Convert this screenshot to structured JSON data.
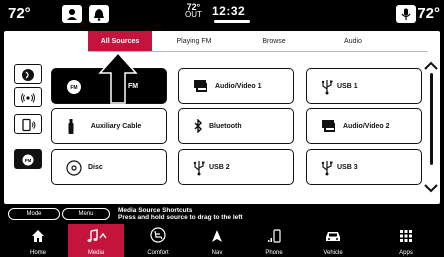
{
  "status": {
    "temp_left": "72°",
    "temp_right": "72°",
    "outside_temp": "72°",
    "outside_label": "OUT",
    "time": "12:32"
  },
  "tabs": [
    {
      "label": "All Sources",
      "active": true
    },
    {
      "label": "Playing FM",
      "active": false
    },
    {
      "label": "Browse",
      "active": false
    },
    {
      "label": "Audio",
      "active": false
    }
  ],
  "sources": [
    {
      "label": "FM",
      "icon": "fm-icon",
      "selected": true
    },
    {
      "label": "Audio/Video 1",
      "icon": "audio-video-icon",
      "selected": false
    },
    {
      "label": "USB 1",
      "icon": "usb-icon",
      "selected": false
    },
    {
      "label": "Auxiliary Cable",
      "icon": "aux-cable-icon",
      "selected": false
    },
    {
      "label": "Bluetooth",
      "icon": "bluetooth-icon",
      "selected": false
    },
    {
      "label": "Audio/Video 2",
      "icon": "audio-video-icon",
      "selected": false
    },
    {
      "label": "Disc",
      "icon": "disc-icon",
      "selected": false
    },
    {
      "label": "USB 2",
      "icon": "usb-icon",
      "selected": false
    },
    {
      "label": "USB 3",
      "icon": "usb-icon",
      "selected": false
    }
  ],
  "shortcuts": {
    "mode_label": "Mode",
    "menu_label": "Menu",
    "title": "Media Source Shortcuts",
    "hint": "Press and hold source to drag to the left"
  },
  "nav": [
    {
      "label": "Home",
      "icon": "home-icon",
      "active": false
    },
    {
      "label": "Media",
      "icon": "music-note-icon",
      "active": true
    },
    {
      "label": "Comfort",
      "icon": "comfort-seat-icon",
      "active": false
    },
    {
      "label": "Nav",
      "icon": "navigation-arrow-icon",
      "active": false
    },
    {
      "label": "Phone",
      "icon": "phone-icon",
      "active": false
    },
    {
      "label": "Vehicle",
      "icon": "car-icon",
      "active": false
    },
    {
      "label": "Apps",
      "icon": "apps-grid-icon",
      "active": false
    }
  ],
  "colors": {
    "accent": "#c4143c",
    "panel": "#ffffff",
    "background": "#000000"
  }
}
